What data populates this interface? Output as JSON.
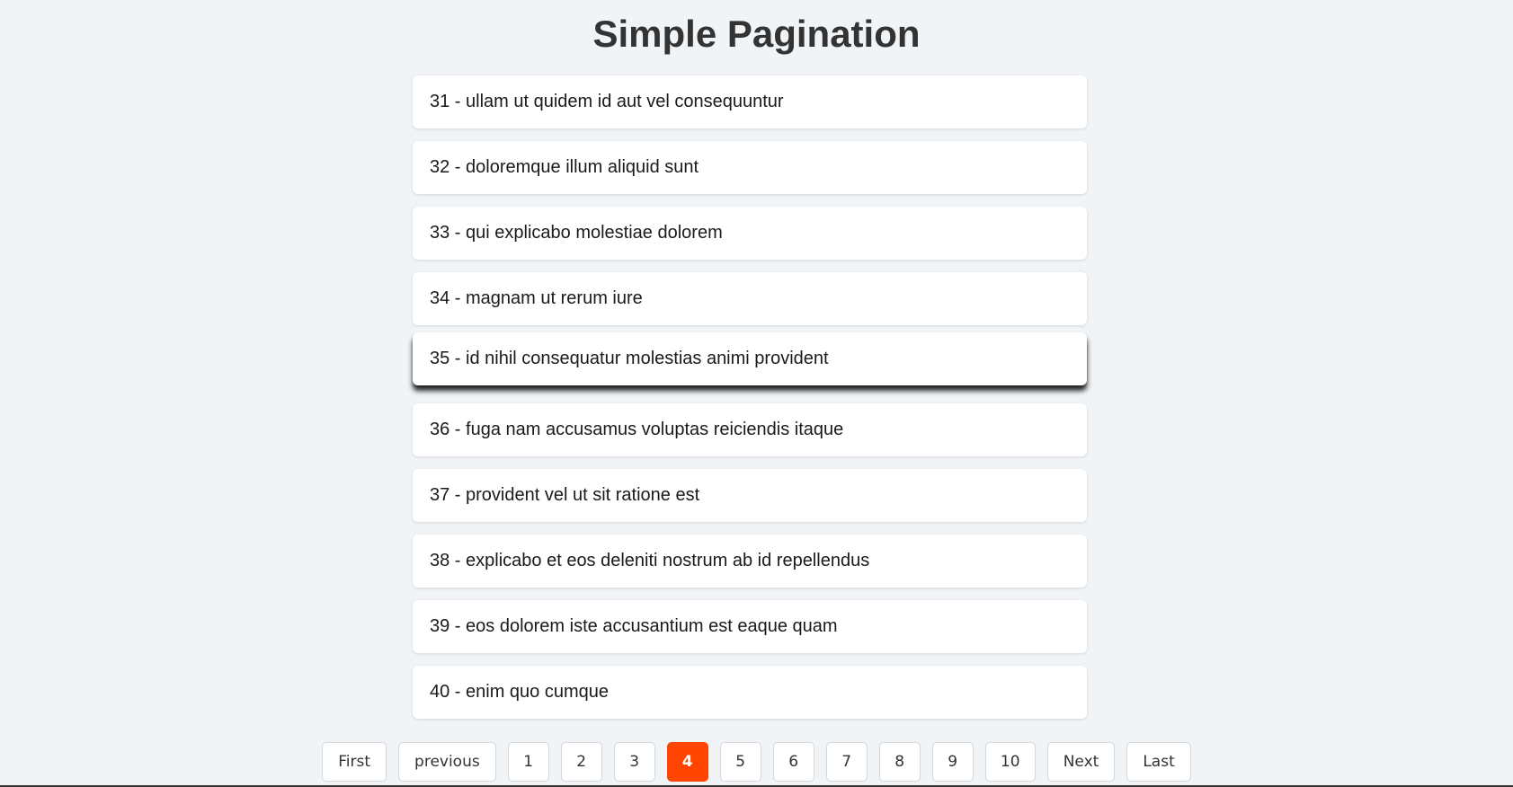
{
  "header": {
    "title": "Simple Pagination"
  },
  "list": {
    "items": [
      {
        "text": "31 - ullam ut quidem id aut vel consequuntur"
      },
      {
        "text": "32 - doloremque illum aliquid sunt"
      },
      {
        "text": "33 - qui explicabo molestiae dolorem"
      },
      {
        "text": "34 - magnam ut rerum iure"
      },
      {
        "text": "35 - id nihil consequatur molestias animi provident"
      },
      {
        "text": "36 - fuga nam accusamus voluptas reiciendis itaque"
      },
      {
        "text": "37 - provident vel ut sit ratione est"
      },
      {
        "text": "38 - explicabo et eos deleniti nostrum ab id repellendus"
      },
      {
        "text": "39 - eos dolorem iste accusantium est eaque quam"
      },
      {
        "text": "40 - enim quo cumque"
      }
    ]
  },
  "pagination": {
    "first_label": "First",
    "previous_label": "previous",
    "pages": [
      "1",
      "2",
      "3",
      "4",
      "5",
      "6",
      "7",
      "8",
      "9",
      "10"
    ],
    "current_page": "4",
    "next_label": "Next",
    "last_label": "Last",
    "active_color": "#ff4500"
  }
}
